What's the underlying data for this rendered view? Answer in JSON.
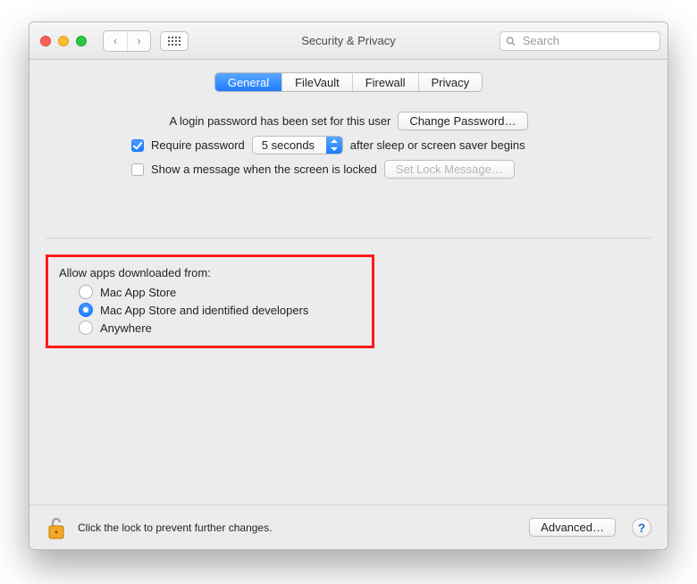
{
  "window": {
    "title": "Security & Privacy"
  },
  "toolbar": {
    "nav_back_glyph": "‹",
    "nav_fwd_glyph": "›"
  },
  "search": {
    "placeholder": "Search"
  },
  "tabs": {
    "general": "General",
    "filevault": "FileVault",
    "firewall": "Firewall",
    "privacy": "Privacy"
  },
  "login": {
    "password_set_text": "A login password has been set for this user",
    "change_password_label": "Change Password…",
    "require_password_label": "Require password",
    "after_sleep_text": "after sleep or screen saver begins",
    "delay_value": "5 seconds",
    "show_message_label": "Show a message when the screen is locked",
    "set_lock_message_label": "Set Lock Message…"
  },
  "gatekeeper": {
    "title": "Allow apps downloaded from:",
    "options": {
      "mas": "Mac App Store",
      "mas_identified": "Mac App Store and identified developers",
      "anywhere": "Anywhere"
    }
  },
  "footer": {
    "lock_text": "Click the lock to prevent further changes.",
    "advanced_label": "Advanced…",
    "help_label": "?"
  }
}
